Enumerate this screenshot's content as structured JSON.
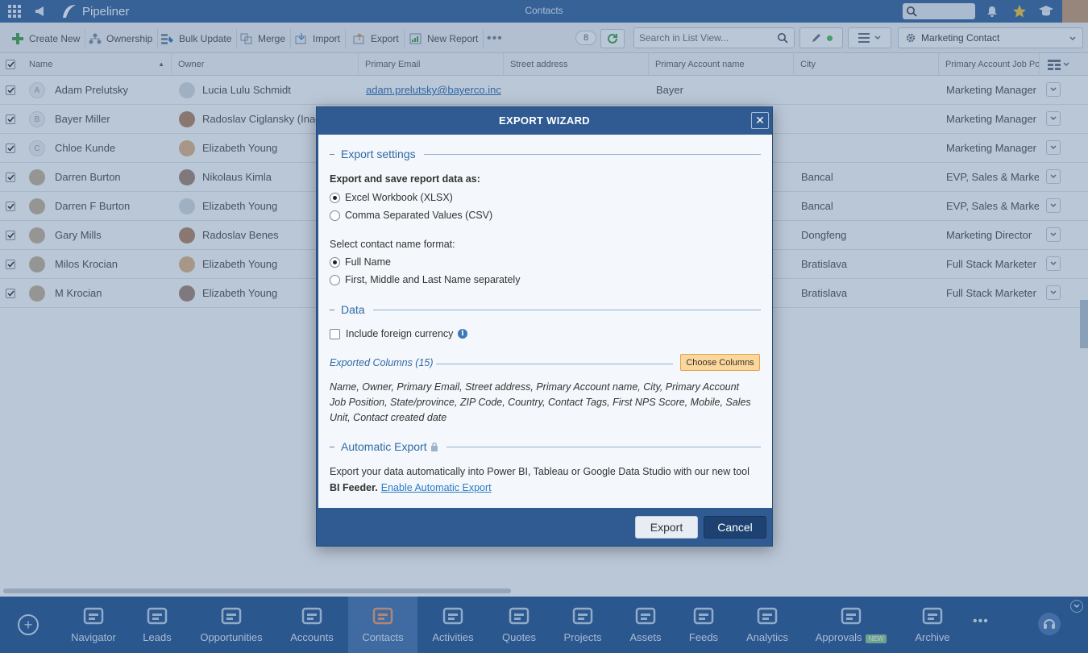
{
  "app": {
    "brand": "Pipeliner",
    "page_title": "Contacts"
  },
  "toolbar": {
    "create_new": "Create New",
    "ownership": "Ownership",
    "bulk_update": "Bulk Update",
    "merge": "Merge",
    "import": "Import",
    "export": "Export",
    "new_report": "New Report",
    "record_count": "8",
    "search_placeholder": "Search in List View...",
    "profile": "Marketing Contact"
  },
  "table": {
    "columns": [
      "Name",
      "Owner",
      "Primary Email",
      "Street address",
      "Primary Account name",
      "City",
      "Primary Account Job Po"
    ],
    "rows": [
      {
        "avatar": "A",
        "name": "Adam Prelutsky",
        "owner": "Lucia Lulu Schmidt",
        "email": "adam.prelutsky@bayerco.inc",
        "account": "Bayer",
        "city": "",
        "job": "Marketing Manager"
      },
      {
        "avatar": "B",
        "name": "Bayer Miller",
        "owner": "Radoslav Ciglansky (Inac",
        "email": "",
        "account": "",
        "city": "",
        "job": "Marketing Manager"
      },
      {
        "avatar": "C",
        "name": "Chloe Kunde",
        "owner": "Elizabeth Young",
        "email": "",
        "account": "",
        "city": "",
        "job": "Marketing Manager"
      },
      {
        "avatar": "",
        "name": "Darren Burton",
        "owner": "Nikolaus Kimla",
        "email": "",
        "account": "",
        "city": "Bancal",
        "job": "EVP, Sales & Marketi"
      },
      {
        "avatar": "",
        "name": "Darren F Burton",
        "owner": "Elizabeth Young",
        "email": "",
        "account": "",
        "city": "Bancal",
        "job": "EVP, Sales & Marketi"
      },
      {
        "avatar": "",
        "name": "Gary Mills",
        "owner": "Radoslav Benes",
        "email": "",
        "account": "",
        "city": "Dongfeng",
        "job": "Marketing Director"
      },
      {
        "avatar": "",
        "name": "Milos Krocian",
        "owner": "Elizabeth Young",
        "email": "",
        "account": "",
        "city": "Bratislava",
        "job": "Full Stack Marketer"
      },
      {
        "avatar": "",
        "name": "M Krocian",
        "owner": "Elizabeth Young",
        "email": "",
        "account": "",
        "city": "Bratislava",
        "job": "Full Stack Marketer"
      }
    ]
  },
  "modal": {
    "title": "EXPORT WIZARD",
    "export_settings": "Export settings",
    "save_as_label": "Export and save report data as:",
    "format_xlsx": "Excel Workbook (XLSX)",
    "format_csv": "Comma Separated Values (CSV)",
    "name_format_label": "Select contact name format:",
    "name_full": "Full Name",
    "name_separate": "First, Middle and Last Name separately",
    "data_section": "Data",
    "include_foreign": "Include foreign currency",
    "exported_columns": "Exported Columns (15)",
    "choose_columns": "Choose Columns",
    "columns_list": "Name, Owner, Primary Email, Street address, Primary Account name, City, Primary Account Job Position, State/province, ZIP Code, Country, Contact Tags, First NPS Score, Mobile, Sales Unit, Contact created date",
    "automatic_export": "Automatic Export",
    "auto_desc_1": "Export your data automatically into Power BI, Tableau or Google Data Studio with our new tool ",
    "auto_desc_bold": "BI Feeder.",
    "auto_link": "Enable Automatic Export",
    "export_btn": "Export",
    "cancel_btn": "Cancel"
  },
  "nav": {
    "items": [
      "Navigator",
      "Leads",
      "Opportunities",
      "Accounts",
      "Contacts",
      "Activities",
      "Quotes",
      "Projects",
      "Assets",
      "Feeds",
      "Analytics",
      "Approvals",
      "Archive"
    ],
    "new_badge": "NEW",
    "active": "Contacts"
  },
  "colors": {
    "topbar": "#3d6aa3",
    "modal_header": "#2f5b92",
    "accent_button": "#fcd79c",
    "cancel_button": "#1d4272"
  }
}
